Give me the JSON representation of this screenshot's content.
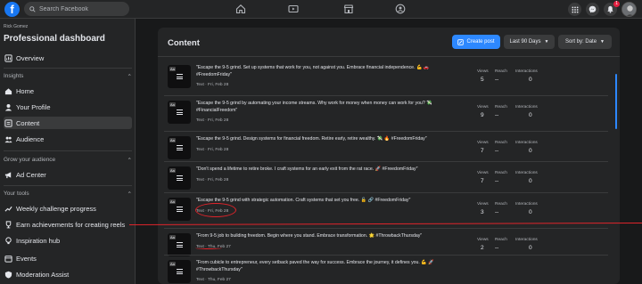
{
  "topbar": {
    "search_placeholder": "Search Facebook",
    "notifications_badge": "1",
    "icons": [
      "home-icon",
      "video-icon",
      "marketplace-icon",
      "groups-icon",
      "menu-grid-icon",
      "messenger-icon",
      "bell-icon"
    ]
  },
  "sidebar": {
    "user_name": "Rick Gomez",
    "title": "Professional dashboard",
    "items_top": [
      {
        "label": "Overview",
        "icon": "overview-icon"
      }
    ],
    "insights": {
      "header": "Insights",
      "items": [
        {
          "label": "Home",
          "icon": "home-icon"
        },
        {
          "label": "Your Profile",
          "icon": "profile-icon"
        },
        {
          "label": "Content",
          "icon": "content-icon",
          "active": true
        },
        {
          "label": "Audience",
          "icon": "audience-icon"
        }
      ]
    },
    "grow": {
      "header": "Grow your audience",
      "items": [
        {
          "label": "Ad Center",
          "icon": "megaphone-icon"
        }
      ]
    },
    "tools": {
      "header": "Your tools",
      "items": [
        {
          "label": "Weekly challenge progress",
          "icon": "trend-icon"
        },
        {
          "label": "Earn achievements for creating reels",
          "icon": "trophy-icon"
        },
        {
          "label": "Inspiration hub",
          "icon": "bulb-icon"
        },
        {
          "label": "Events",
          "icon": "calendar-icon"
        },
        {
          "label": "Moderation Assist",
          "icon": "shield-icon"
        }
      ]
    }
  },
  "content": {
    "title": "Content",
    "create_post": "Create post",
    "date_range": "Last 90 Days",
    "sort": "Sort by: Date",
    "column_labels": {
      "views": "Views",
      "reach": "Reach",
      "interactions": "Interactions"
    },
    "posts": [
      {
        "text": "\"Escape the 9-5 grind. Set up systems that work for you, not against you. Embrace financial independence. 💪 🚗 #FreedomFriday\"",
        "date": "Text · Fri, Feb 28",
        "views": "5",
        "reach": "--",
        "interactions": "0"
      },
      {
        "text": "\"Escape the 9-5 grind by automating your income streams. Why work for money when money can work for you? 💸 #FinancialFreedom\"",
        "date": "Text · Fri, Feb 28",
        "views": "9",
        "reach": "--",
        "interactions": "0"
      },
      {
        "text": "\"Escape the 9-5 grind. Design systems for financial freedom. Retire early, retire wealthy. 💸 🔥 #FreedomFriday\"",
        "date": "Text · Fri, Feb 28",
        "views": "7",
        "reach": "--",
        "interactions": "0"
      },
      {
        "text": "\"Don't spend a lifetime to retire broke. I craft systems for an early exit from the rat race. 🚀 #FreedomFriday\"",
        "date": "Text · Fri, Feb 28",
        "views": "7",
        "reach": "--",
        "interactions": "0"
      },
      {
        "text": "\"Escape the 9-5 grind with strategic automation. Craft systems that set you free. 🔓 🔗 #FreedomFriday\"",
        "date": "Text · Fri, Feb 28",
        "views": "3",
        "reach": "--",
        "interactions": "0"
      },
      {
        "text": "\"From 9-5 job to building freedom. Begin where you stand. Embrace transformation. 🌟 #ThrowbackThursday\"",
        "date": "Text · Thu, Feb 27",
        "views": "2",
        "reach": "--",
        "interactions": "0"
      },
      {
        "text": "\"From cubicle to entrepreneur, every setback paved the way for success. Embrace the journey, it defines you. 💪 🚀 #ThrowbackThursday\"",
        "date": "Text · Thu, Feb 27",
        "views": "",
        "reach": "",
        "interactions": ""
      }
    ]
  },
  "colors": {
    "background": "#18191a",
    "surface": "#242526",
    "accent": "#2d88ff",
    "annotation": "#e0242b"
  }
}
